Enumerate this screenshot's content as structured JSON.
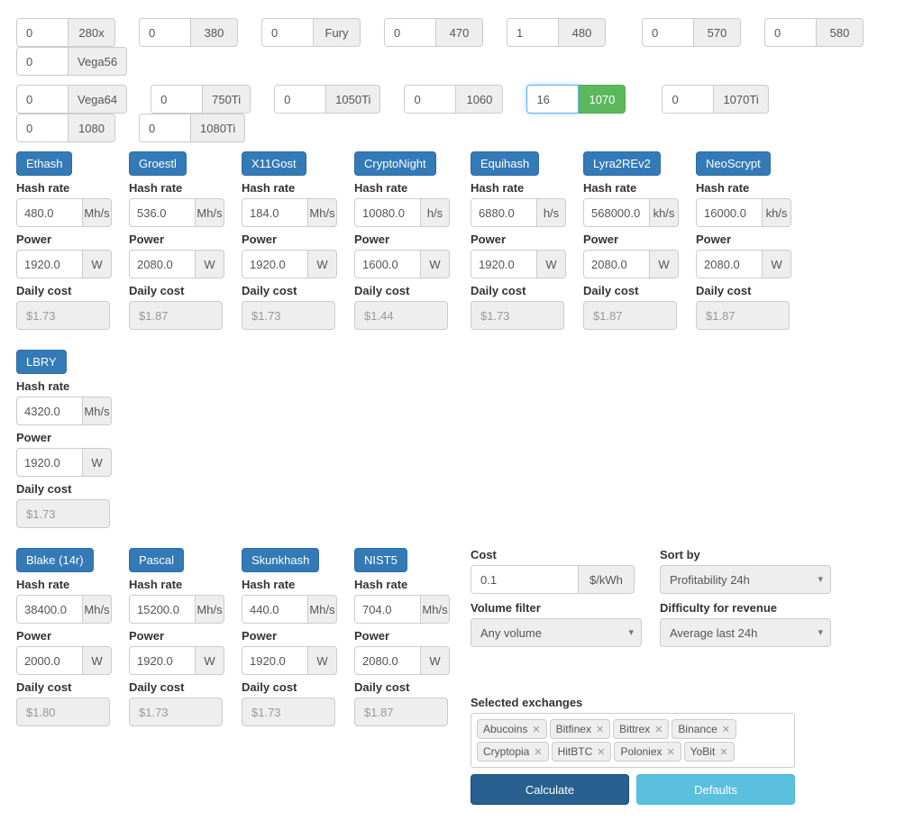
{
  "gpus": {
    "row1": [
      {
        "id": "gpu-280x",
        "val": "0",
        "label": "280x"
      },
      {
        "id": "gpu-380",
        "val": "0",
        "label": "380"
      },
      {
        "id": "gpu-fury",
        "val": "0",
        "label": "Fury"
      },
      {
        "id": "gpu-470",
        "val": "0",
        "label": "470"
      },
      {
        "id": "gpu-480",
        "val": "1",
        "label": "480",
        "spacedWide": true
      },
      {
        "id": "gpu-570",
        "val": "0",
        "label": "570"
      },
      {
        "id": "gpu-580",
        "val": "0",
        "label": "580"
      },
      {
        "id": "gpu-vega56",
        "val": "0",
        "label": "Vega56"
      }
    ],
    "row2": [
      {
        "id": "gpu-vega64",
        "val": "0",
        "label": "Vega64"
      },
      {
        "id": "gpu-750ti",
        "val": "0",
        "label": "750Ti"
      },
      {
        "id": "gpu-1050ti",
        "val": "0",
        "label": "1050Ti"
      },
      {
        "id": "gpu-1060",
        "val": "0",
        "label": "1060"
      },
      {
        "id": "gpu-1070",
        "val": "16",
        "label": "1070",
        "active": true,
        "focused": true,
        "spacedWide": true
      },
      {
        "id": "gpu-1070ti",
        "val": "0",
        "label": "1070Ti"
      },
      {
        "id": "gpu-1080",
        "val": "0",
        "label": "1080"
      },
      {
        "id": "gpu-1080ti",
        "val": "0",
        "label": "1080Ti"
      }
    ]
  },
  "algos_top": [
    {
      "name": "Ethash",
      "rv": "480.0",
      "ru": "Mh/s",
      "pw": "1920.0",
      "dc": "$1.73"
    },
    {
      "name": "Groestl",
      "rv": "536.0",
      "ru": "Mh/s",
      "pw": "2080.0",
      "dc": "$1.87"
    },
    {
      "name": "X11Gost",
      "rv": "184.0",
      "ru": "Mh/s",
      "pw": "1920.0",
      "dc": "$1.73"
    },
    {
      "name": "CryptoNight",
      "rv": "10080.0",
      "ru": "h/s",
      "pw": "1600.0",
      "dc": "$1.44"
    },
    {
      "name": "Equihash",
      "rv": "6880.0",
      "ru": "h/s",
      "pw": "1920.0",
      "dc": "$1.73",
      "offset": true
    },
    {
      "name": "Lyra2REv2",
      "rv": "568000.0",
      "ru": "kh/s",
      "pw": "2080.0",
      "dc": "$1.87"
    },
    {
      "name": "NeoScrypt",
      "rv": "16000.0",
      "ru": "kh/s",
      "pw": "2080.0",
      "dc": "$1.87"
    },
    {
      "name": "LBRY",
      "rv": "4320.0",
      "ru": "Mh/s",
      "pw": "1920.0",
      "dc": "$1.73"
    }
  ],
  "algos_bottom": [
    {
      "name": "Blake (14r)",
      "rv": "38400.0",
      "ru": "Mh/s",
      "pw": "2000.0",
      "dc": "$1.80"
    },
    {
      "name": "Pascal",
      "rv": "15200.0",
      "ru": "Mh/s",
      "pw": "1920.0",
      "dc": "$1.73"
    },
    {
      "name": "Skunkhash",
      "rv": "440.0",
      "ru": "Mh/s",
      "pw": "1920.0",
      "dc": "$1.73"
    },
    {
      "name": "NIST5",
      "rv": "704.0",
      "ru": "Mh/s",
      "pw": "2080.0",
      "dc": "$1.87"
    }
  ],
  "labels": {
    "hash": "Hash rate",
    "power": "Power",
    "pwu": "W",
    "daily": "Daily cost",
    "cost": "Cost",
    "costv": "0.1",
    "costu": "$/kWh",
    "sortby": "Sort by",
    "sortv": "Profitability 24h",
    "vol": "Volume filter",
    "volv": "Any volume",
    "diff": "Difficulty for revenue",
    "diffv": "Average last 24h",
    "selex": "Selected exchanges",
    "calc": "Calculate",
    "def": "Defaults"
  },
  "exchanges": [
    "Abucoins",
    "Bitfinex",
    "Bittrex",
    "Binance",
    "Cryptopia",
    "HitBTC",
    "Poloniex",
    "YoBit"
  ]
}
